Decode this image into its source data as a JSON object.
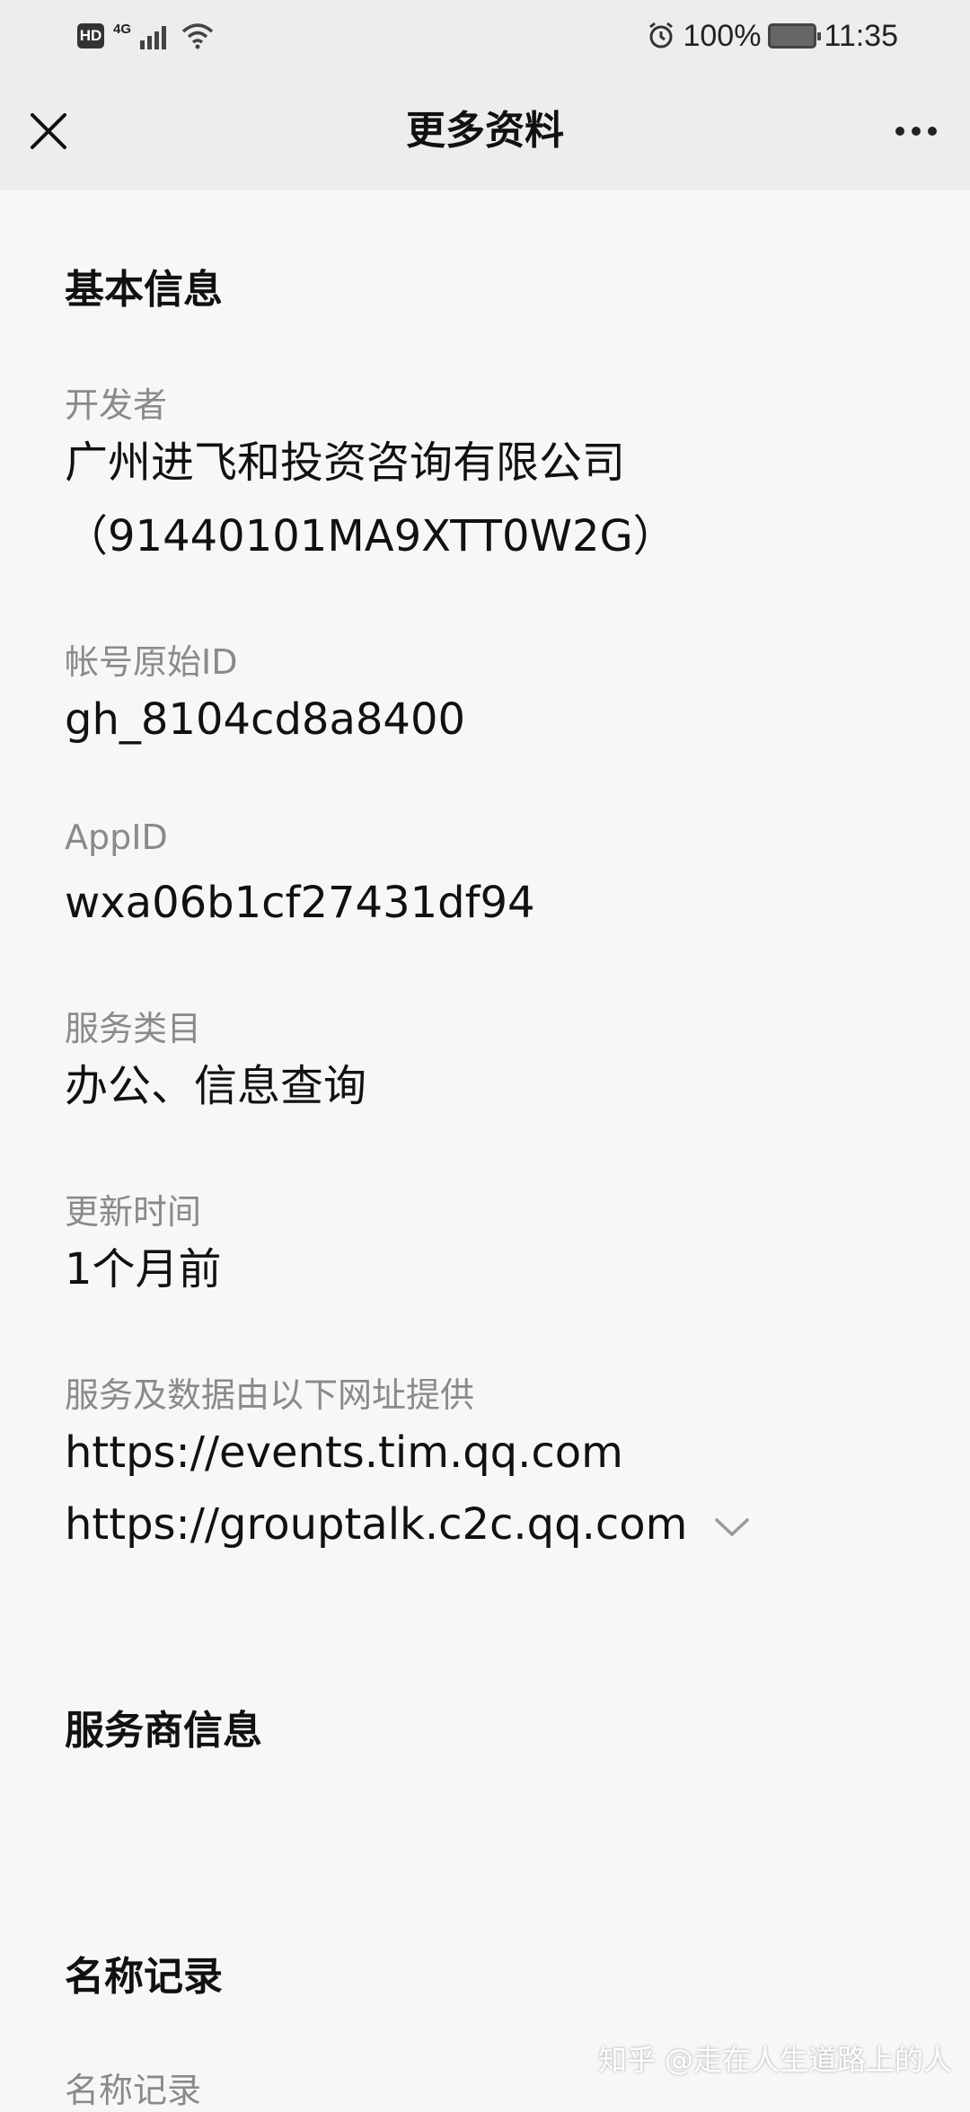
{
  "status_bar": {
    "hd": "HD",
    "network": "4G",
    "battery_pct": "100%",
    "time": "11:35"
  },
  "nav": {
    "title": "更多资料"
  },
  "sections": {
    "basic_info": "基本信息",
    "provider_info": "服务商信息",
    "name_record": "名称记录"
  },
  "fields": {
    "developer": {
      "label": "开发者",
      "value_line1": "广州进飞和投资咨询有限公司",
      "value_line2": "（91440101MA9XTT0W2G）"
    },
    "original_id": {
      "label": "帐号原始ID",
      "value": "gh_8104cd8a8400"
    },
    "app_id": {
      "label": "AppID",
      "value": "wxa06b1cf27431df94"
    },
    "service_category": {
      "label": "服务类目",
      "value": "办公、信息查询"
    },
    "update_time": {
      "label": "更新时间",
      "value": "1个月前"
    },
    "domains": {
      "label": "服务及数据由以下网址提供",
      "urls": [
        "https://events.tim.qq.com",
        "https://grouptalk.c2c.qq.com"
      ]
    },
    "name_record": {
      "label": "名称记录"
    }
  },
  "watermark": "知乎 @走在人生道路上的人",
  "icons": {
    "close": "close-icon",
    "more": "more-icon",
    "expand": "chevron-down-icon",
    "alarm": "alarm-icon",
    "wifi": "wifi-icon",
    "signal": "signal-icon",
    "battery": "battery-icon"
  }
}
